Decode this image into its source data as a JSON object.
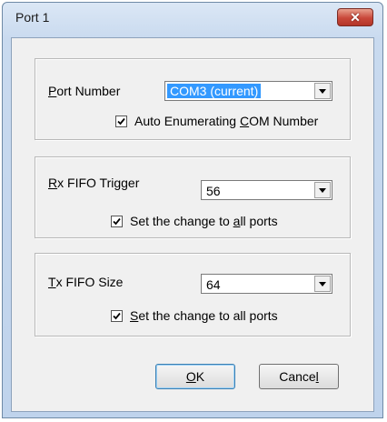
{
  "window": {
    "title": "Port 1"
  },
  "port_group": {
    "label_mnemonic": "P",
    "label_rest": "ort Number",
    "port_value": "COM3 (current)",
    "auto_enum_checked": true,
    "auto_enum_prefix": "Auto Enumerating ",
    "auto_enum_mnemonic": "C",
    "auto_enum_rest": "OM Number"
  },
  "rx_group": {
    "label_mnemonic": "R",
    "label_rest": "x FIFO Trigger",
    "value": "56",
    "set_all_checked": true,
    "set_all_prefix": "Set the change to ",
    "set_all_mnemonic": "a",
    "set_all_rest": "ll ports"
  },
  "tx_group": {
    "label_mnemonic": "T",
    "label_rest": "x FIFO Size",
    "value": "64",
    "set_all_checked": true,
    "set_all_mnemonic": "S",
    "set_all_rest": "et the change to all ports"
  },
  "buttons": {
    "ok_mnemonic": "O",
    "ok_rest": "K",
    "cancel_prefix": "Cance",
    "cancel_mnemonic": "l"
  },
  "colors": {
    "selection": "#3399ff",
    "close_button": "#c9483a",
    "title_bar": "#c9daef"
  },
  "icons": {
    "close": "close-x-icon",
    "dropdown": "chevron-down-icon",
    "check": "checkmark-icon"
  }
}
